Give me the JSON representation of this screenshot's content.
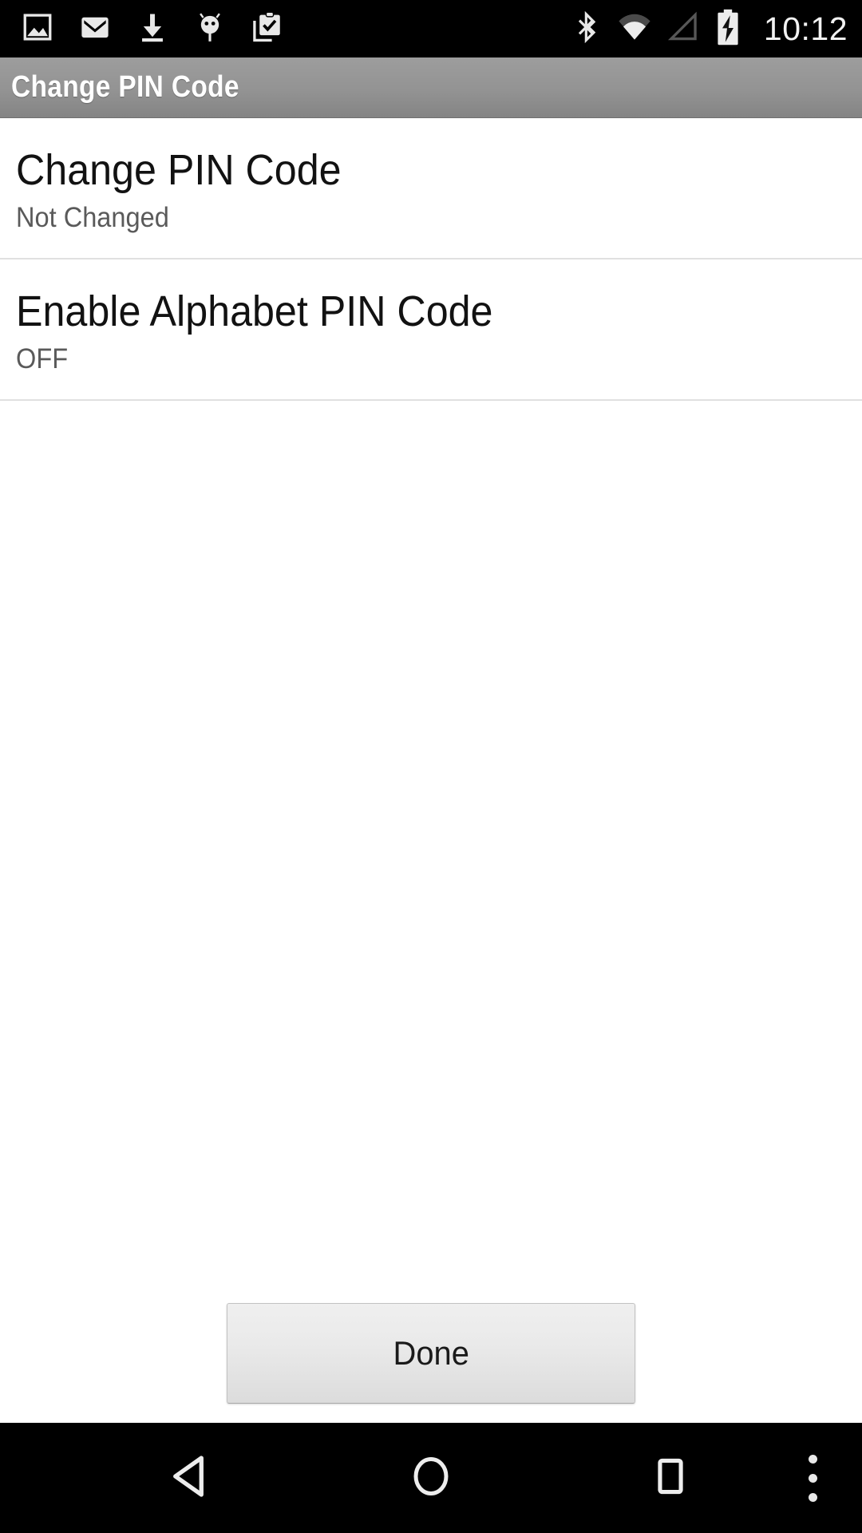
{
  "status_bar": {
    "background": "#000000",
    "clock": "10:12",
    "left_icons": [
      {
        "name": "image-icon",
        "label": "Screenshot / Gallery"
      },
      {
        "name": "gmail-icon",
        "label": "Gmail"
      },
      {
        "name": "download-icon",
        "label": "Download"
      },
      {
        "name": "android-debug-icon",
        "label": "USB debugging"
      },
      {
        "name": "clipboard-check-icon",
        "label": "Task complete"
      }
    ],
    "right_icons": [
      {
        "name": "bluetooth-icon",
        "label": "Bluetooth on"
      },
      {
        "name": "wifi-icon",
        "label": "Wi-Fi signal"
      },
      {
        "name": "cellular-signal-icon",
        "label": "No cellular signal"
      },
      {
        "name": "battery-charging-icon",
        "label": "Battery charging"
      }
    ]
  },
  "title_bar": {
    "title": "Change PIN Code",
    "background_top": "#9d9d9d",
    "background_bottom": "#848484",
    "text_color": "#ffffff"
  },
  "preferences": {
    "items": [
      {
        "title": "Change PIN Code",
        "summary": "Not Changed"
      },
      {
        "title": "Enable Alphabet PIN Code",
        "summary": "OFF"
      }
    ]
  },
  "footer": {
    "done_label": "Done"
  },
  "navigation_bar": {
    "background": "#000000",
    "buttons": [
      {
        "name": "back-button",
        "label": "Back"
      },
      {
        "name": "home-button",
        "label": "Home"
      },
      {
        "name": "recents-button",
        "label": "Recent apps"
      },
      {
        "name": "overflow-menu-button",
        "label": "More options"
      }
    ]
  }
}
